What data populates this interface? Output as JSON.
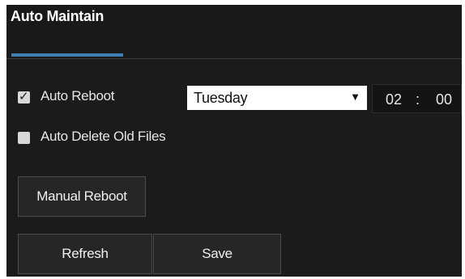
{
  "panel": {
    "title": "Auto Maintain"
  },
  "auto_reboot": {
    "label": "Auto Reboot",
    "checked": true,
    "day_selected": "Tuesday",
    "hour": "02",
    "separator": ":",
    "minute": "00"
  },
  "auto_delete": {
    "label": "Auto Delete Old Files",
    "checked": false
  },
  "buttons": {
    "manual_reboot": "Manual Reboot",
    "refresh": "Refresh",
    "save": "Save"
  },
  "colors": {
    "panel_bg": "#1b1b1b",
    "accent": "#3f7fb3",
    "text": "#e6e6e6"
  }
}
